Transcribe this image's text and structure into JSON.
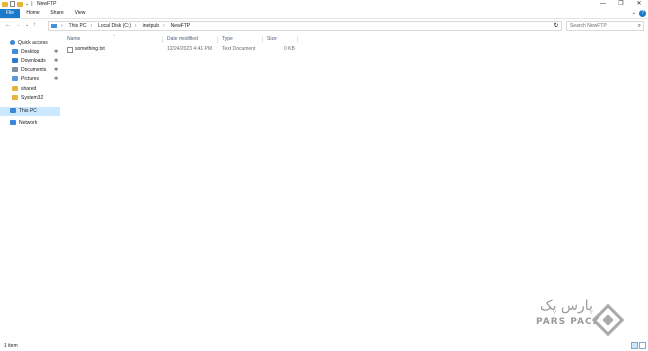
{
  "window": {
    "title": "NewFTP",
    "controls": {
      "minimize": "—",
      "maximize": "❐",
      "close": "✕"
    }
  },
  "ribbon": {
    "tabs": [
      "File",
      "Home",
      "Share",
      "View"
    ],
    "expand_icon": "chevron-down-icon",
    "help_label": "?"
  },
  "nav": {
    "back": "←",
    "forward": "→",
    "recent": "⌄",
    "up": "↑"
  },
  "address": {
    "crumbs": [
      "This PC",
      "Local Disk (C:)",
      "inetpub",
      "NewFTP"
    ],
    "separator": "›",
    "dropdown": "⌄",
    "refresh": "↻"
  },
  "search": {
    "placeholder": "Search NewFTP",
    "icon": "search-icon"
  },
  "sidebar": {
    "quick_access": {
      "label": "Quick access",
      "color": "#3a86d8"
    },
    "items": [
      {
        "label": "Desktop",
        "icon": "desktop-icon",
        "color": "#3a8ee0",
        "pinned": true
      },
      {
        "label": "Downloads",
        "icon": "download-icon",
        "color": "#2d7bd0",
        "pinned": true
      },
      {
        "label": "Documents",
        "icon": "documents-icon",
        "color": "#7e8fa3",
        "pinned": true
      },
      {
        "label": "Pictures",
        "icon": "pictures-icon",
        "color": "#5b9bd5",
        "pinned": true
      },
      {
        "label": "shared",
        "icon": "folder-icon",
        "color": "#e8b33a",
        "pinned": false
      },
      {
        "label": "System32",
        "icon": "folder-icon",
        "color": "#e8b33a",
        "pinned": false
      }
    ],
    "this_pc": {
      "label": "This PC",
      "color": "#3a86d8"
    },
    "network": {
      "label": "Network",
      "color": "#3a86d8"
    },
    "pin_glyph": "✱"
  },
  "columns": {
    "name": "Name",
    "date": "Date modified",
    "type": "Type",
    "size": "Size",
    "sort_arrow": "^"
  },
  "files": [
    {
      "name": "something.txt",
      "date": "12/24/2023 4:41 PM",
      "type": "Text Document",
      "size": "0 KB"
    }
  ],
  "status": {
    "item_count": "1 item"
  },
  "watermark": {
    "persian": "پارس پک",
    "english": "PARS PACK"
  }
}
